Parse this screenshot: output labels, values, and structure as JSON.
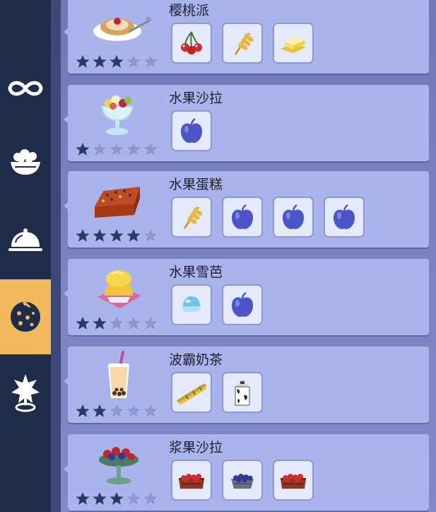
{
  "sidebar": {
    "items": [
      {
        "icon": "infinity-icon",
        "active": false
      },
      {
        "icon": "salad-bowl-icon",
        "active": false
      },
      {
        "icon": "cloche-icon",
        "active": false
      },
      {
        "icon": "cookie-icon",
        "active": true
      },
      {
        "icon": "star-pin-icon",
        "active": false
      }
    ]
  },
  "recipes": [
    {
      "name": "樱桃派",
      "stars": 3,
      "max_stars": 5,
      "dish_icon": "cherry-pie-icon",
      "ingredients": [
        "cherry-icon",
        "wheat-icon",
        "butter-icon"
      ]
    },
    {
      "name": "水果沙拉",
      "stars": 1,
      "max_stars": 5,
      "dish_icon": "fruit-salad-icon",
      "ingredients": [
        "apple-icon"
      ]
    },
    {
      "name": "水果蛋糕",
      "stars": 4,
      "max_stars": 5,
      "dish_icon": "fruit-cake-icon",
      "ingredients": [
        "wheat-icon",
        "apple-icon",
        "apple-icon",
        "apple-icon"
      ]
    },
    {
      "name": "水果雪芭",
      "stars": 2,
      "max_stars": 5,
      "dish_icon": "fruit-sorbet-icon",
      "ingredients": [
        "ice-icon",
        "apple-icon"
      ]
    },
    {
      "name": "波霸奶茶",
      "stars": 2,
      "max_stars": 5,
      "dish_icon": "bubble-tea-icon",
      "ingredients": [
        "sugarcane-icon",
        "milk-carton-icon"
      ]
    },
    {
      "name": "浆果沙拉",
      "stars": 3,
      "max_stars": 5,
      "dish_icon": "berry-salad-icon",
      "ingredients": [
        "berry-crate-icon",
        "blueberry-basket-icon",
        "berry-crate-icon"
      ]
    }
  ],
  "colors": {
    "sidebar_bg": "#1f2c4a",
    "active_tab": "#f2b95a",
    "card_bg": "#aab4ec",
    "star_filled": "#2a3a66",
    "star_empty": "#8c96cc",
    "apple": "#4b55c8"
  }
}
